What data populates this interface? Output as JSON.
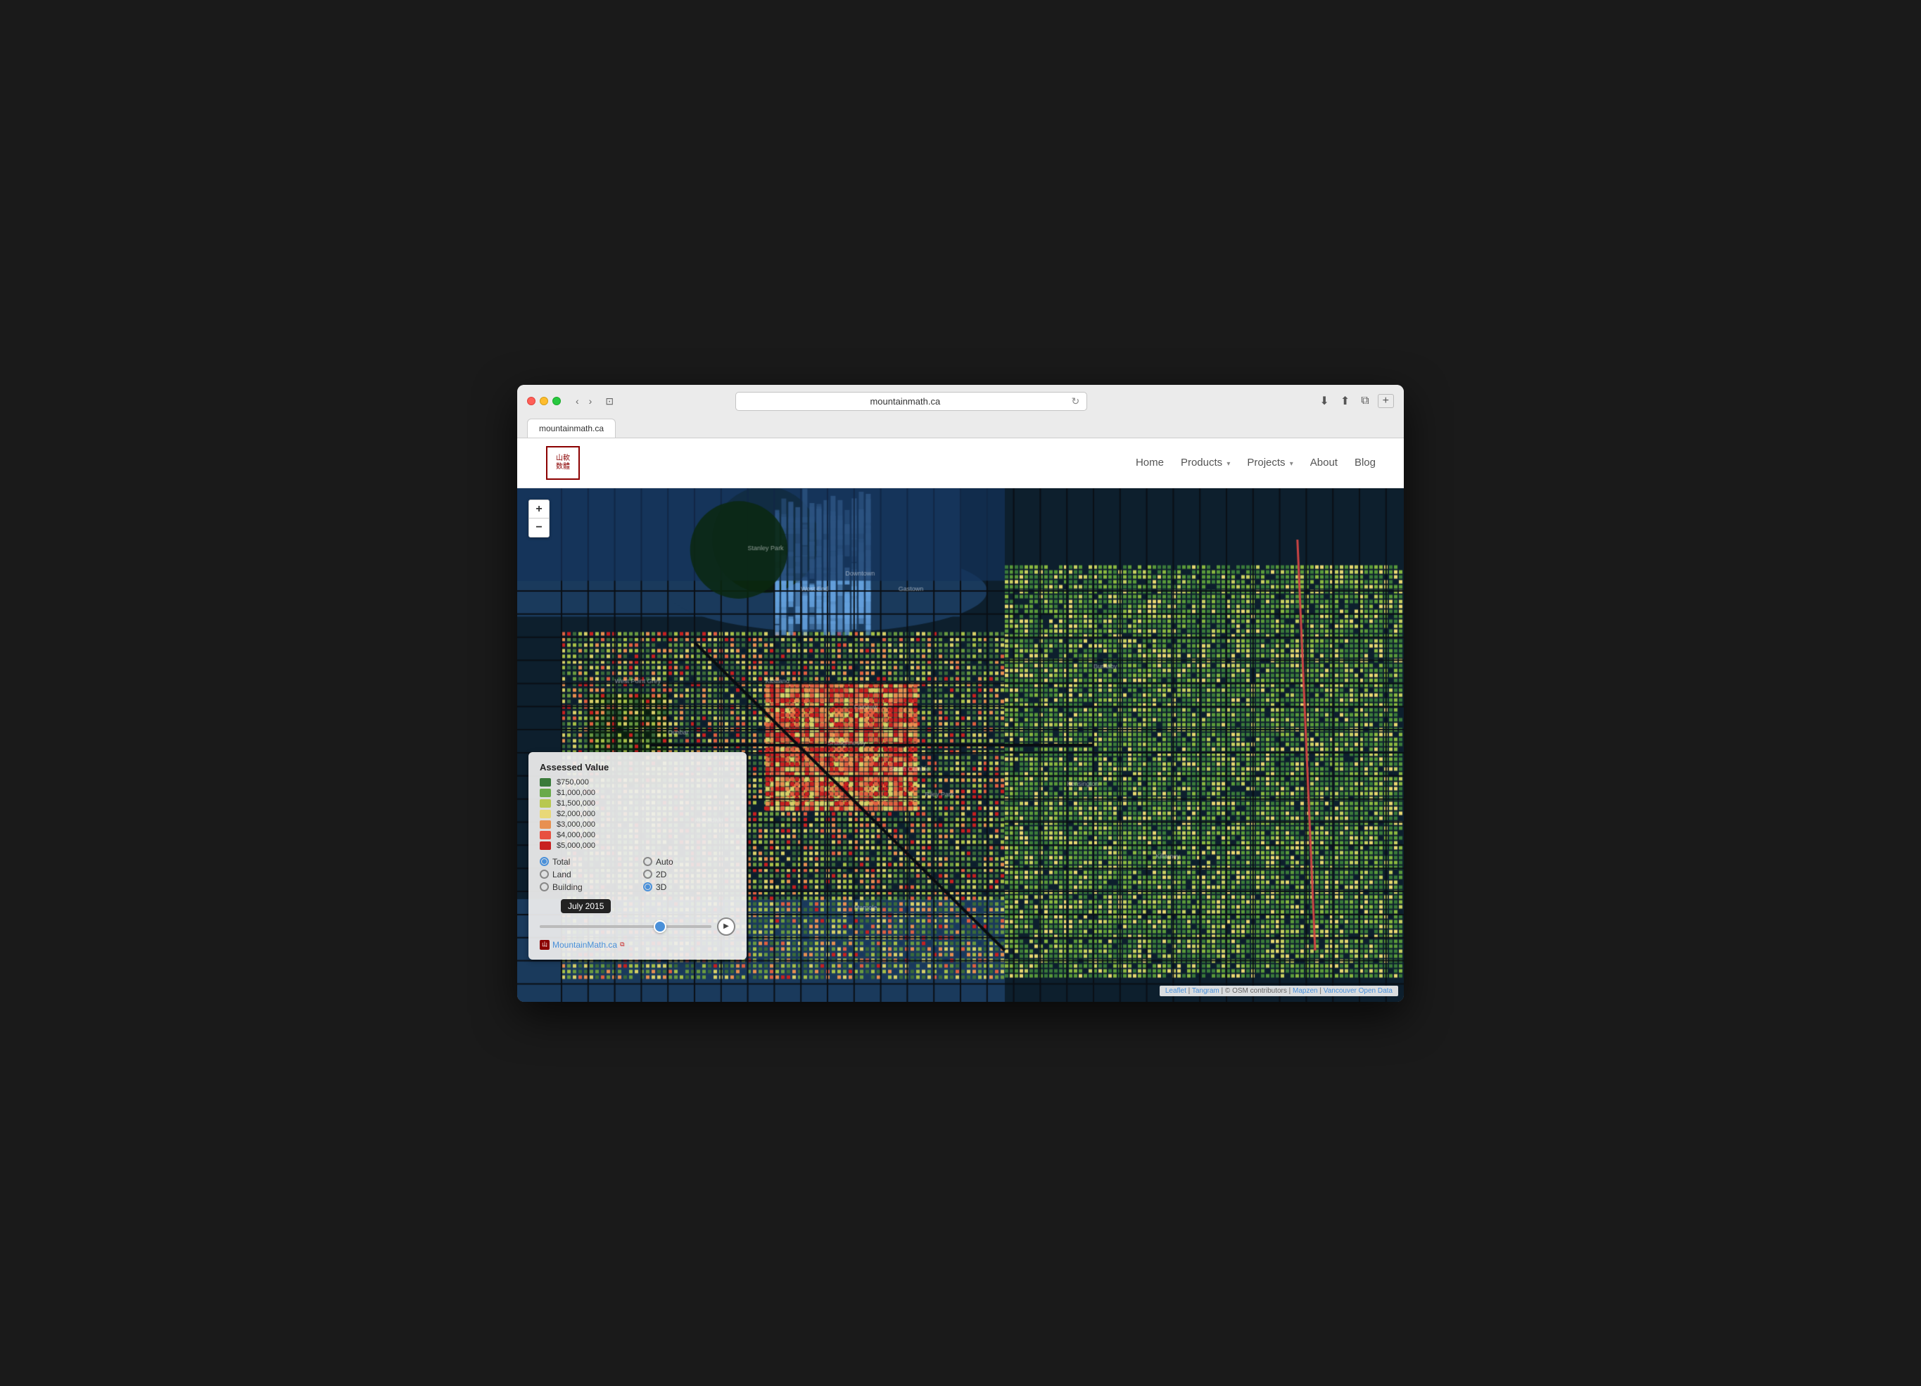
{
  "browser": {
    "url": "mountainmath.ca",
    "tab_title": "mountainmath.ca"
  },
  "navbar": {
    "logo_line1": "山軟",
    "logo_line2": "数體",
    "nav_items": [
      {
        "label": "Home",
        "has_dropdown": false
      },
      {
        "label": "Products",
        "has_dropdown": true
      },
      {
        "label": "Projects",
        "has_dropdown": true
      },
      {
        "label": "About",
        "has_dropdown": false
      },
      {
        "label": "Blog",
        "has_dropdown": false
      }
    ]
  },
  "map": {
    "zoom_in_label": "+",
    "zoom_out_label": "−"
  },
  "legend": {
    "title": "Assessed Value",
    "items": [
      {
        "label": "$750,000",
        "color": "#3a7a3a"
      },
      {
        "label": "$1,000,000",
        "color": "#6aaa4a"
      },
      {
        "label": "$1,500,000",
        "color": "#b8c850"
      },
      {
        "label": "$2,000,000",
        "color": "#e8d878"
      },
      {
        "label": "$3,000,000",
        "color": "#e89050"
      },
      {
        "label": "$4,000,000",
        "color": "#e85040"
      },
      {
        "label": "$5,000,000",
        "color": "#c82020"
      }
    ],
    "radio_groups": [
      [
        {
          "label": "Total",
          "active": true
        },
        {
          "label": "Auto",
          "active": true
        }
      ],
      [
        {
          "label": "Land",
          "active": false
        },
        {
          "label": "2D",
          "active": false
        }
      ],
      [
        {
          "label": "Building",
          "active": false
        },
        {
          "label": "3D",
          "active": true
        }
      ]
    ],
    "date_label": "July 2015",
    "link_text": "MountainMath.ca",
    "play_icon": "▶"
  },
  "attribution": {
    "parts": [
      "Leaflet",
      " | ",
      "Tangram",
      " | © OSM contributors | ",
      "Mapzen",
      " | ",
      "Vancouver Open Data"
    ]
  }
}
